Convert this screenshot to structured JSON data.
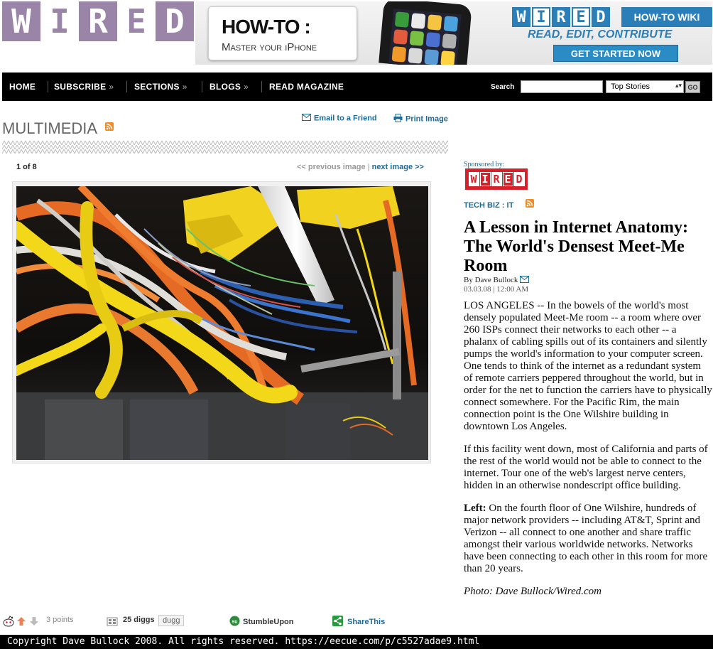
{
  "brand": {
    "logo_letters": [
      "W",
      "I",
      "R",
      "E",
      "D"
    ],
    "accent_purple": "#9a84a8",
    "accent_blue": "#2b7fb8",
    "link_blue": "#1a6a9a",
    "wired_red": "#d6202a"
  },
  "ad": {
    "title": "HOW-TO :",
    "subtitle": "Master your iPhone",
    "mini_logo_letters": [
      "W",
      "I",
      "R",
      "E",
      "D"
    ],
    "wiki_label": "HOW-TO WIKI",
    "tagline": "READ, EDIT, CONTRIBUTE",
    "cta": "GET STARTED NOW"
  },
  "nav": {
    "items": [
      {
        "label": "HOME",
        "chevron": ""
      },
      {
        "label": "SUBSCRIBE",
        "chevron": "»"
      },
      {
        "label": "SECTIONS",
        "chevron": "»"
      },
      {
        "label": "BLOGS",
        "chevron": "»"
      },
      {
        "label": "READ MAGAZINE",
        "chevron": ""
      }
    ],
    "search_label": "Search",
    "search_value": "",
    "select_value": "Top Stories",
    "go_label": "GO"
  },
  "multimedia": {
    "title": "MULTIMEDIA",
    "email_label": "Email to a Friend",
    "print_label": "Print Image",
    "pager_count": "1 of 8",
    "prev_label": "<< previous image",
    "separator": "|",
    "next_label": "next image >>"
  },
  "social": {
    "points": "3 points",
    "diggs": "25 diggs",
    "dugg": "dugg",
    "stumble": "StumbleUpon",
    "sharethis": "ShareThis"
  },
  "article": {
    "sponsored_by": "Sponsored by:",
    "sponsor_letters": [
      "W",
      "I",
      "R",
      "E",
      "D"
    ],
    "section": "TECH BIZ",
    "section_sep": ":",
    "subsection": "IT",
    "headline": "A Lesson in Internet Anatomy: The World's Densest Meet-Me Room",
    "byline": "By Dave Bullock",
    "date": "03.03.08 | 12:00 AM",
    "paragraph1": "LOS ANGELES -- In the bowels of the world's most densely populated Meet-Me room -- a room where over 260 ISPs connect their networks to each other -- a phalanx of cabling spills out of its containers and silently pumps the world's information to your computer screen. One tends to think of the internet as a redundant system of remote carriers peppered throughout the world, but in order for the net to function the carriers have to physically connect somewhere. For the Pacific Rim, the main connection point is the One Wilshire building in downtown Los Angeles.",
    "paragraph2": "If this facility went down, most of California and parts of the rest of the world would not be able to connect to the internet. Tour one of the web's largest nerve centers, hidden in an otherwise nondescript office building.",
    "paragraph3_lead": "Left:",
    "paragraph3": " On the fourth floor of One Wilshire, hundreds of major network providers -- including AT&T, Sprint and Verizon -- all connect to one another and share traffic amongst their various worldwide networks. Networks have been connecting to each other in this room for more than 20 years.",
    "credit": "Photo: Dave Bullock/Wired.com"
  },
  "status_bar": "Copyright Dave Bullock 2008. All rights reserved. https://eecue.com/p/c5527adae9.html"
}
